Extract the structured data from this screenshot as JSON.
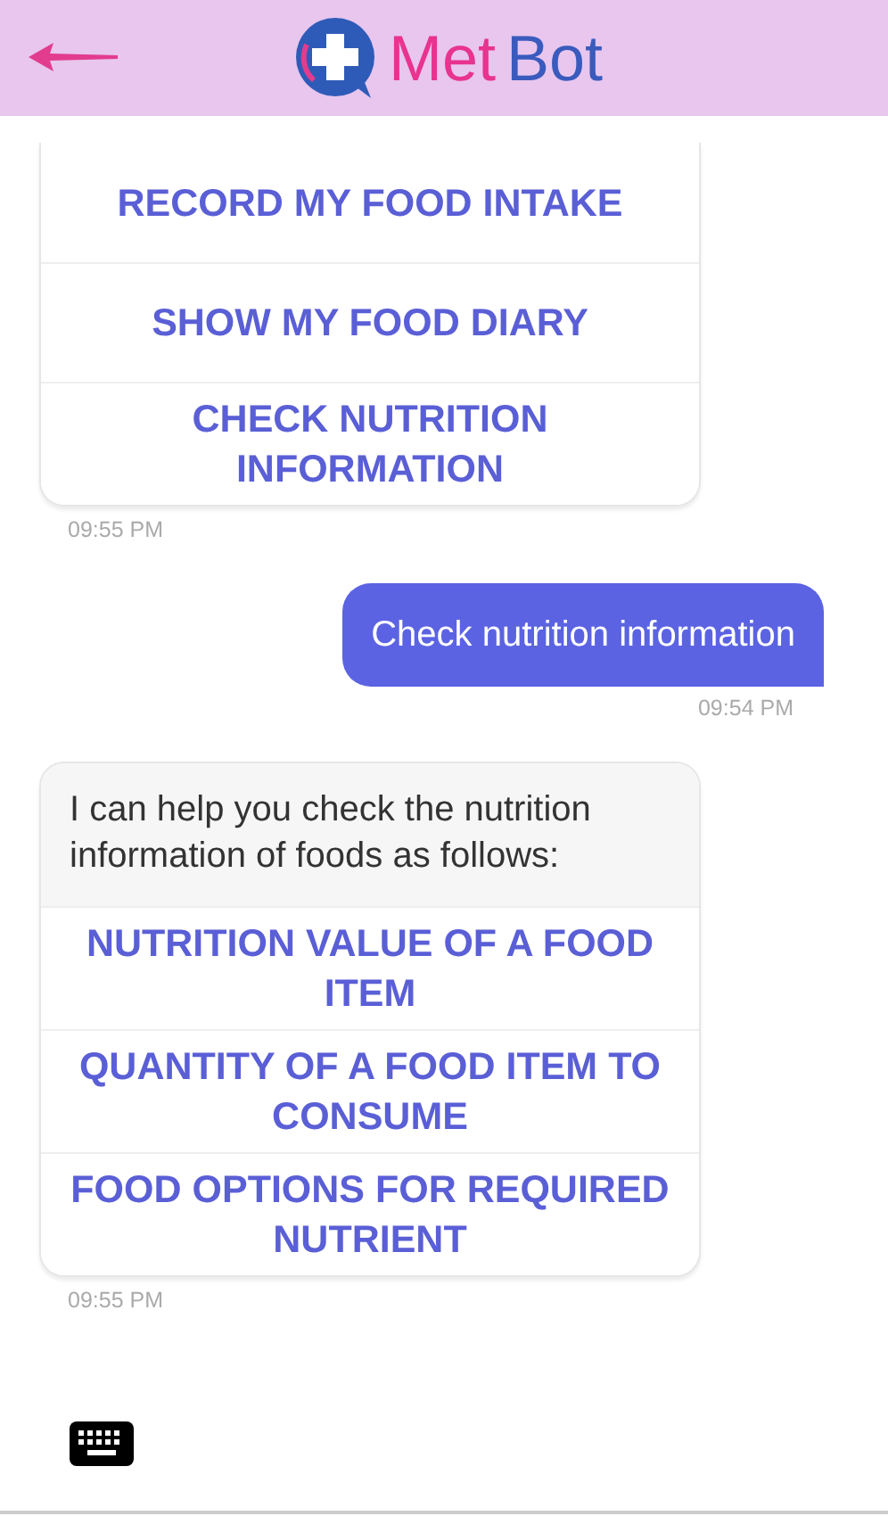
{
  "header": {
    "title_first": "Met",
    "title_second": "Bot"
  },
  "messages": [
    {
      "kind": "bot",
      "time": "09:55 PM",
      "options": [
        "RECORD MY FOOD INTAKE",
        "SHOW MY FOOD DIARY",
        "CHECK NUTRITION INFORMATION"
      ]
    },
    {
      "kind": "user",
      "text": "Check nutrition information",
      "time": "09:54 PM"
    },
    {
      "kind": "bot",
      "text": "I can help you check the nutrition information of foods as follows:",
      "time": "09:55 PM",
      "options": [
        "NUTRITION VALUE OF A FOOD ITEM",
        "QUANTITY OF A FOOD ITEM TO CONSUME",
        "FOOD OPTIONS FOR REQUIRED NUTRIENT"
      ]
    }
  ]
}
